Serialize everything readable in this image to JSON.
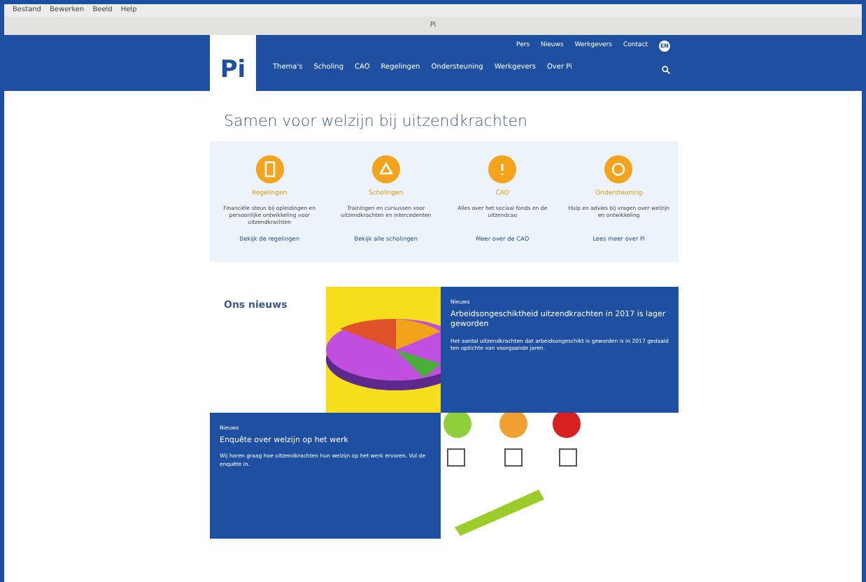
{
  "browser": {
    "menu": [
      "Bestand",
      "Bewerken",
      "Beeld",
      "Help"
    ],
    "title": "Pi"
  },
  "header": {
    "logo": "Pi",
    "top_links": [
      "Pers",
      "Nieuws",
      "Werkgevers",
      "Contact"
    ],
    "language": "EN",
    "nav": [
      {
        "label": "Thema's",
        "selected": false
      },
      {
        "label": "Scholing",
        "selected": false
      },
      {
        "label": "CAO",
        "selected": false
      },
      {
        "label": "Regelingen",
        "selected": false
      },
      {
        "label": "Ondersteuning",
        "selected": false
      },
      {
        "label": "Werkgevers",
        "selected": false
      },
      {
        "label": "Over Pi",
        "selected": false
      }
    ]
  },
  "heading": "Samen voor welzijn bij uitzendkrachten",
  "features": [
    {
      "title": "Regelingen",
      "text": "Financiële steun bij opleidingen en persoonlijke ontwikkeling voor uitzendkrachten",
      "link": "Bekijk de regelingen"
    },
    {
      "title": "Scholingen",
      "text": "Trainingen en cursussen voor uitzendkrachten en intercedenten",
      "link": "Bekijk alle scholingen"
    },
    {
      "title": "CAO",
      "text": "Alles over het sociaal fonds en de uitzendcao",
      "link": "Meer over de CAO"
    },
    {
      "title": "Ondersteuning",
      "text": "Hulp en advies bij vragen over welzijn en ontwikkeling",
      "link": "Lees meer over Pi"
    }
  ],
  "news": {
    "title": "Ons nieuws",
    "items": [
      {
        "tag": "Nieuws",
        "title": "Arbeidsongeschiktheid uitzendkrachten in 2017 is lager geworden",
        "text": "Het aantal uitzendkrachten dat arbeidsongeschikt is geworden is in 2017 gedaald ten opzichte van voorgaande jaren."
      },
      {
        "tag": "Nieuws",
        "title": "Enquête over welzijn op het werk",
        "text": "Wij horen graag hoe uitzendkrachten hun welzijn op het werk ervaren. Vul de enquête in."
      }
    ]
  }
}
